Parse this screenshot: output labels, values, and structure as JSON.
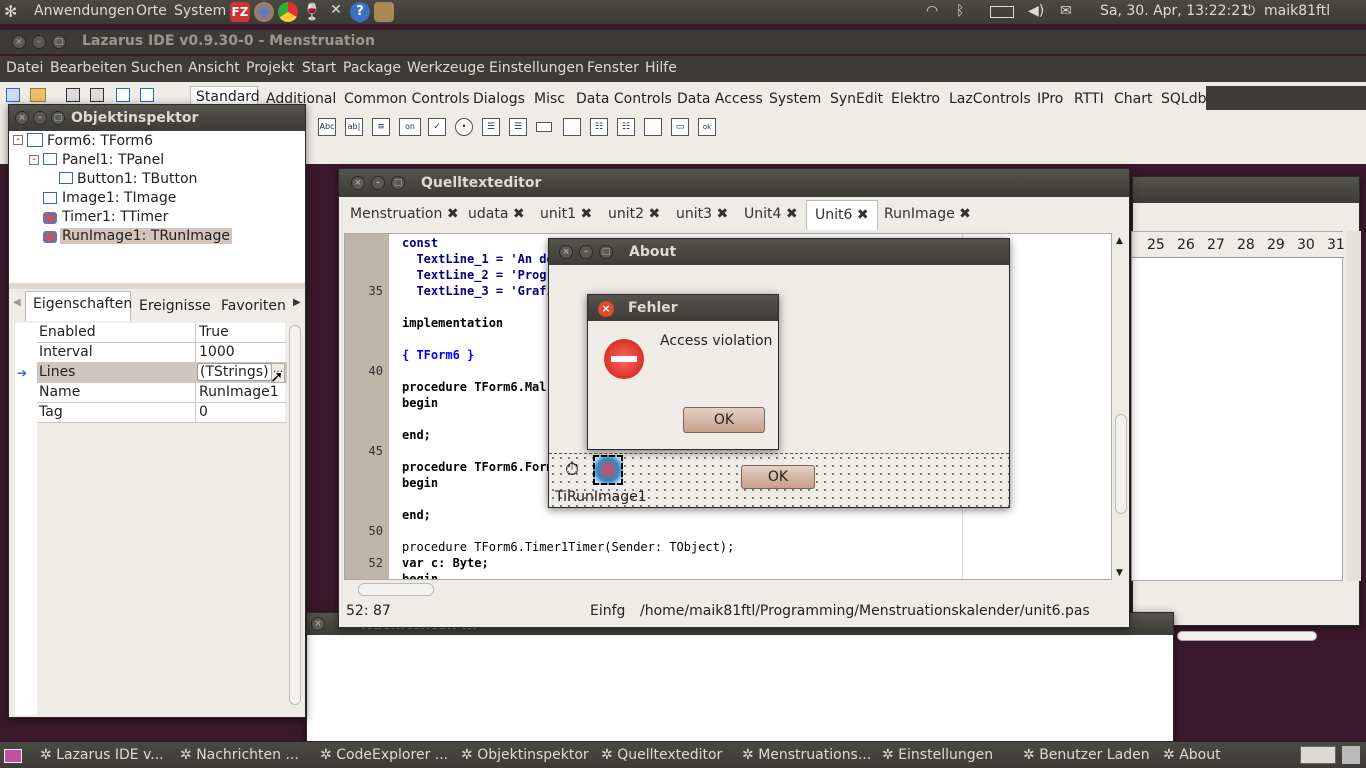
{
  "top_panel": {
    "menus": [
      "Anwendungen",
      "Orte",
      "System"
    ],
    "clock": "Sa, 30. Apr, 13:22:21",
    "user": "maik81ftl"
  },
  "ide": {
    "title": "Lazarus IDE v0.9.30-0 - Menstruation",
    "menu": [
      "Datei",
      "Bearbeiten",
      "Suchen",
      "Ansicht",
      "Projekt",
      "Start",
      "Package",
      "Werkzeuge",
      "Einstellungen",
      "Fenster",
      "Hilfe"
    ],
    "palette_tabs": [
      "Standard",
      "Additional",
      "Common Controls",
      "Dialogs",
      "Misc",
      "Data Controls",
      "Data Access",
      "System",
      "SynEdit",
      "Elektro",
      "LazControls",
      "IPro",
      "RTTI",
      "Chart",
      "SQLdb"
    ],
    "palette_icons": [
      "Abc",
      "ab|",
      "on"
    ]
  },
  "inspector": {
    "title": "Objektinspektor",
    "tree": [
      "Form6: TForm6",
      "Panel1: TPanel",
      "Button1: TButton",
      "Image1: TImage",
      "Timer1: TTimer",
      "RunImage1: TRunImage"
    ],
    "tabs": [
      "Eigenschaften",
      "Ereignisse",
      "Favoriten"
    ],
    "properties": [
      {
        "name": "Enabled",
        "value": "True"
      },
      {
        "name": "Interval",
        "value": "1000"
      },
      {
        "name": "Lines",
        "value": "(TStrings)"
      },
      {
        "name": "Name",
        "value": "RunImage1"
      },
      {
        "name": "Tag",
        "value": "0"
      }
    ]
  },
  "editor": {
    "title": "Quelltexteditor",
    "tabs": [
      "Menstruation",
      "udata",
      "unit1",
      "unit2",
      "unit3",
      "Unit4",
      "Unit6",
      "RunImage"
    ],
    "active_tab": "Unit6",
    "line_numbers": [
      "35",
      "40",
      "45",
      "50",
      "52"
    ],
    "code": [
      "const",
      "  TextLine_1 = 'An de",
      "  TextLine_2 = 'Progr",
      "  TextLine_3 = 'Grafi",
      "implementation",
      "{ TForm6 }",
      "procedure TForm6.Mal",
      "begin",
      "end;",
      "procedure TForm6.Form",
      "begin",
      "end;",
      "procedure TForm6.Timer1Timer(Sender: TObject);",
      "var c: Byte;",
      "begin"
    ],
    "status": {
      "pos": "52: 87",
      "mode": "Einfg",
      "path": "/home/maik81ftl/Programming/Menstruationskalender/unit6.pas"
    }
  },
  "about": {
    "title": "About",
    "ok": "OK",
    "component_label": "TiRunImage1"
  },
  "error": {
    "title": "Fehler",
    "message": "Access violation",
    "ok": "OK"
  },
  "calendar": {
    "days": [
      "25",
      "26",
      "27",
      "28",
      "29",
      "30",
      "31"
    ]
  },
  "messages": {
    "title": "Nachrichten ..."
  },
  "taskbar": [
    "Lazarus IDE v...",
    "Nachrichten ...",
    "CodeExplorer ...",
    "Objektinspektor",
    "Quelltexteditor",
    "Menstruations...",
    "Einstellungen",
    "Benutzer Laden",
    "About"
  ]
}
